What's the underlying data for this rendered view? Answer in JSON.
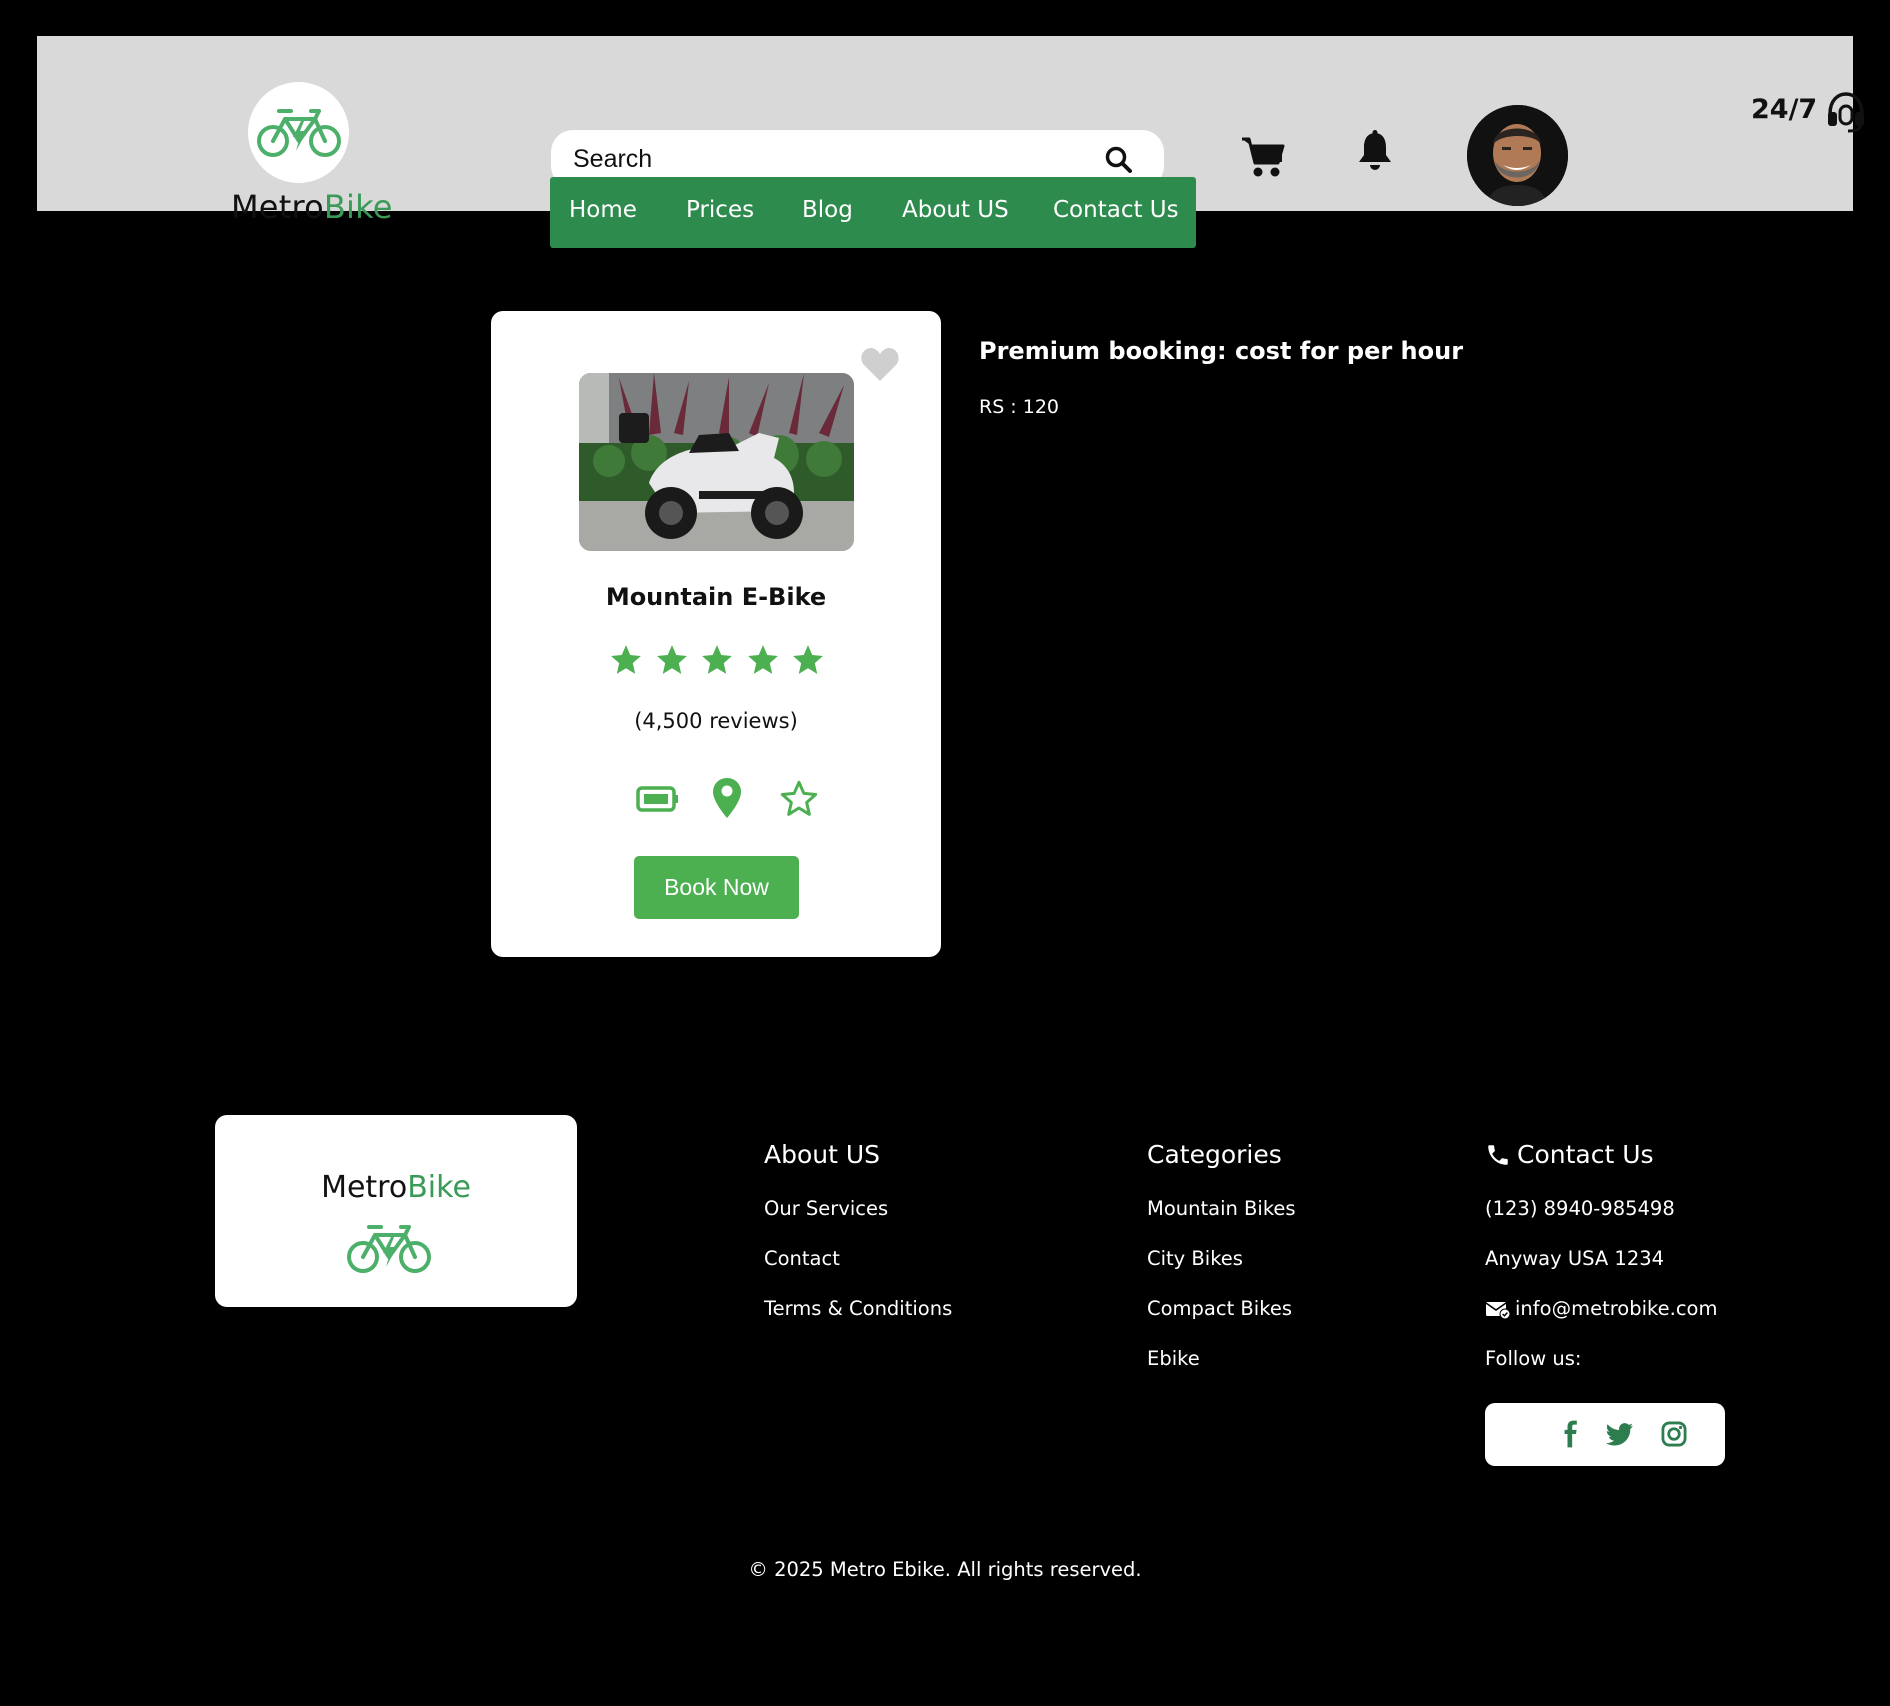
{
  "brand": {
    "name_part1": "Metro",
    "name_part2": "Bike",
    "green": "#3a9a57"
  },
  "search": {
    "placeholder": "Search"
  },
  "header": {
    "support_label": "24/7"
  },
  "icons": {
    "logo": "bike-icon",
    "search": "search-icon",
    "cart": "cart-icon",
    "notifications": "bell-icon",
    "support": "headset-icon"
  },
  "nav": {
    "items": [
      "Home",
      "Prices",
      "Blog",
      "About US",
      "Contact Us"
    ],
    "bg": "#2e8b4e"
  },
  "product": {
    "name": "Mountain E-Bike",
    "rating": 5,
    "reviews": "(4,500 reviews)",
    "button_label": "Book Now",
    "accent": "#4caf50"
  },
  "booking": {
    "title": "Premium booking: cost for per hour",
    "price": "RS : 120"
  },
  "footer": {
    "logo": {
      "name_part1": "Metro",
      "name_part2": "Bike"
    },
    "about": {
      "heading": "About US",
      "links": [
        "Our Services",
        "Contact",
        "Terms & Conditions"
      ]
    },
    "categories": {
      "heading": "Categories",
      "links": [
        "Mountain Bikes",
        "City Bikes",
        "Compact Bikes",
        "Ebike"
      ]
    },
    "contact": {
      "heading": "Contact Us",
      "phone": "(123) 8940-985498",
      "address": "Anyway USA 1234",
      "email": "info@metrobike.com",
      "follow": "Follow us:"
    },
    "social": [
      "facebook-icon",
      "twitter-icon",
      "instagram-icon"
    ],
    "copyright": "© 2025 Metro Ebike. All rights reserved."
  }
}
